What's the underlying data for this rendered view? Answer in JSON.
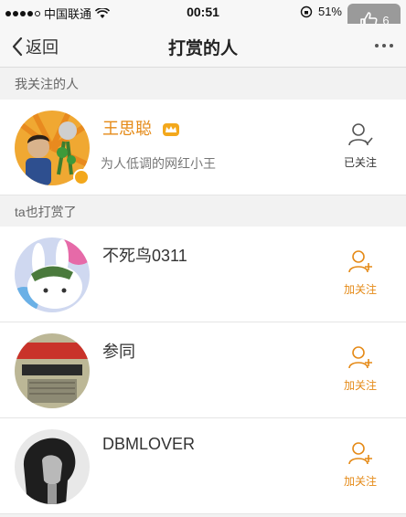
{
  "status_bar": {
    "carrier": "中国联通",
    "time": "00:51",
    "battery": "51%"
  },
  "like_badge": {
    "count": "6"
  },
  "nav": {
    "back_label": "返回",
    "title": "打赏的人"
  },
  "sections": {
    "following": "我关注的人",
    "rewarded": "ta也打赏了"
  },
  "followed_user": {
    "name": "王思聪",
    "description": "为人低调的网红小王",
    "follow_label": "已关注"
  },
  "users": [
    {
      "name": "不死鸟0311",
      "follow_label": "加关注"
    },
    {
      "name": "参同",
      "follow_label": "加关注"
    },
    {
      "name": "DBMLOVER",
      "follow_label": "加关注"
    }
  ],
  "colors": {
    "accent": "#e58a17",
    "background": "#f2f2f2"
  }
}
